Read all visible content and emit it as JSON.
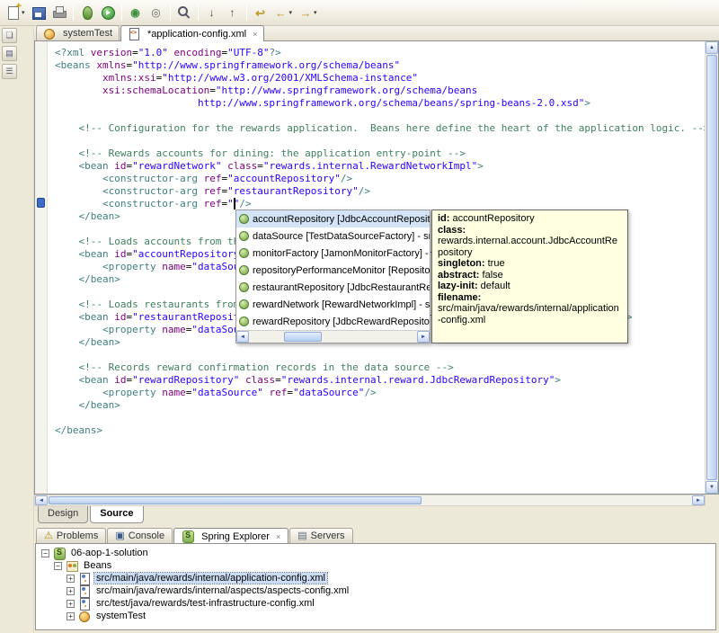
{
  "colors": {
    "tag": "#3f7f7f",
    "attribute": "#7f007f",
    "value": "#2a00ff",
    "comment": "#3f7f5f",
    "completion_selection": "#d4e4f7",
    "tooltip_bg": "#ffffe1"
  },
  "icons": {
    "dropdown": "▾",
    "close": "×",
    "scroll_up": "▲",
    "scroll_down": "▼",
    "scroll_left": "◄",
    "scroll_right": "►",
    "expanded": "−",
    "collapsed": "+"
  },
  "toolbar": {
    "buttons": [
      {
        "name": "new-wizard",
        "glyph": "",
        "dropdown": true
      },
      {
        "name": "save",
        "glyph": ""
      },
      {
        "name": "print",
        "glyph": ""
      },
      {
        "name": "sep"
      },
      {
        "name": "debug",
        "glyph": ""
      },
      {
        "name": "run",
        "glyph": ""
      },
      {
        "name": "sep"
      },
      {
        "name": "new-java-class",
        "glyph": "◉"
      },
      {
        "name": "open-type",
        "glyph": "◎"
      },
      {
        "name": "sep"
      },
      {
        "name": "search",
        "glyph": ""
      },
      {
        "name": "sep"
      },
      {
        "name": "next-annotation",
        "glyph": "↓"
      },
      {
        "name": "previous-annotation",
        "glyph": "↑"
      },
      {
        "name": "sep"
      },
      {
        "name": "last-edit-location",
        "glyph": "↩"
      },
      {
        "name": "back",
        "glyph": "←",
        "dropdown": true
      },
      {
        "name": "forward",
        "glyph": "→",
        "dropdown": true
      }
    ]
  },
  "left_rail": {
    "icons": [
      {
        "name": "restore-views",
        "glyph": "❏"
      },
      {
        "name": "package-explorer-fast-view",
        "glyph": "▤"
      },
      {
        "name": "outline-fast-view",
        "glyph": "☰"
      }
    ]
  },
  "editor": {
    "tabs": [
      {
        "label": "systemTest",
        "icon": "bean",
        "active": false,
        "closable": true
      },
      {
        "label": "*application-config.xml",
        "icon": "xml-file",
        "active": true,
        "closable": true
      }
    ],
    "page_tabs": [
      {
        "label": "Design",
        "active": false
      },
      {
        "label": "Source",
        "active": true
      }
    ],
    "cursor": {
      "line": 13,
      "col": 30
    },
    "code_lines": [
      "<?xml version=\"1.0\" encoding=\"UTF-8\"?>",
      "<beans xmlns=\"http://www.springframework.org/schema/beans\"",
      "        xmlns:xsi=\"http://www.w3.org/2001/XMLSchema-instance\"",
      "        xsi:schemaLocation=\"http://www.springframework.org/schema/beans",
      "                        http://www.springframework.org/schema/beans/spring-beans-2.0.xsd\">",
      "",
      "    <!-- Configuration for the rewards application.  Beans here define the heart of the application logic. -->",
      "",
      "    <!-- Rewards accounts for dining: the application entry-point -->",
      "    <bean id=\"rewardNetwork\" class=\"rewards.internal.RewardNetworkImpl\">",
      "        <constructor-arg ref=\"accountRepository\"/>",
      "        <constructor-arg ref=\"restaurantRepository\"/>",
      "        <constructor-arg ref=\"\"/>",
      "    </bean>",
      "",
      "    <!-- Loads accounts from the data source -->",
      "    <bean id=\"accountRepository\" class=\"rewards.internal.account.JdbcAccountRepository\">",
      "        <property name=\"dataSource\" ref=\"dataSource\"/>",
      "    </bean>",
      "",
      "    <!-- Loads restaurants from the data source -->",
      "    <bean id=\"restaurantRepository\" class=\"rewards.internal.restaurant.JdbcRestaurantRepository\">",
      "        <property name=\"dataSource\" ref=\"dataSource\"/>",
      "    </bean>",
      "",
      "    <!-- Records reward confirmation records in the data source -->",
      "    <bean id=\"rewardRepository\" class=\"rewards.internal.reward.JdbcRewardRepository\">",
      "        <property name=\"dataSource\" ref=\"dataSource\"/>",
      "    </bean>",
      "",
      "</beans>"
    ]
  },
  "completion_popup": {
    "items": [
      {
        "label": "accountRepository [JdbcAccountRepository] - src/main/java/rewards/internal/application-config.xml",
        "selected": true
      },
      {
        "label": "dataSource [TestDataSourceFactory] - src/test/java/rewards/test-infrastructure-config.xml",
        "selected": false
      },
      {
        "label": "monitorFactory [JamonMonitorFactory] - src/main/java/rewards/internal/aspects/aspects-config.xml",
        "selected": false
      },
      {
        "label": "repositoryPerformanceMonitor [RepositoryPerformanceMonitor] - src/main/java",
        "selected": false
      },
      {
        "label": "restaurantRepository [JdbcRestaurantRepository] - src/main/java/rewards/internal",
        "selected": false
      },
      {
        "label": "rewardNetwork [RewardNetworkImpl] - src/main/java/rewards/internal/application-config.xml",
        "selected": false
      },
      {
        "label": "rewardRepository [JdbcRewardRepository] - src/main/java/rewards/internal/application-config.xml",
        "selected": false
      }
    ]
  },
  "bean_tooltip": {
    "fields": [
      {
        "label": "id:",
        "value": "accountRepository",
        "inline": true
      },
      {
        "label": "class:",
        "value": "rewards.internal.account.JdbcAccountRepository",
        "inline": false
      },
      {
        "label": "singleton:",
        "value": "true",
        "inline": true
      },
      {
        "label": "abstract:",
        "value": "false",
        "inline": true
      },
      {
        "label": "lazy-init:",
        "value": "default",
        "inline": true
      },
      {
        "label": "filename:",
        "value": "src/main/java/rewards/internal/application-config.xml",
        "inline": true
      }
    ]
  },
  "bottom_panel": {
    "tabs": [
      {
        "label": "Problems",
        "icon": "problems",
        "glyph": "⚠",
        "active": false
      },
      {
        "label": "Console",
        "icon": "console",
        "glyph": "▣",
        "active": false
      },
      {
        "label": "Spring Explorer",
        "icon": "spring",
        "glyph": "",
        "active": true,
        "closable": true
      },
      {
        "label": "Servers",
        "icon": "servers",
        "glyph": "▤",
        "active": false
      }
    ],
    "tree": [
      {
        "label": "06-aop-1-solution",
        "level": 0,
        "expander": "expanded",
        "icon": "spring-project",
        "selected": false
      },
      {
        "label": "Beans",
        "level": 1,
        "expander": "expanded",
        "icon": "beans",
        "selected": false
      },
      {
        "label": "src/main/java/rewards/internal/application-config.xml",
        "level": 2,
        "expander": "collapsed",
        "icon": "config-file",
        "selected": true
      },
      {
        "label": "src/main/java/rewards/internal/aspects/aspects-config.xml",
        "level": 2,
        "expander": "collapsed",
        "icon": "config-file",
        "selected": false
      },
      {
        "label": "src/test/java/rewards/test-infrastructure-config.xml",
        "level": 2,
        "expander": "collapsed",
        "icon": "config-file",
        "selected": false
      },
      {
        "label": "systemTest",
        "level": 2,
        "expander": "collapsed",
        "icon": "bean",
        "selected": false
      }
    ]
  }
}
